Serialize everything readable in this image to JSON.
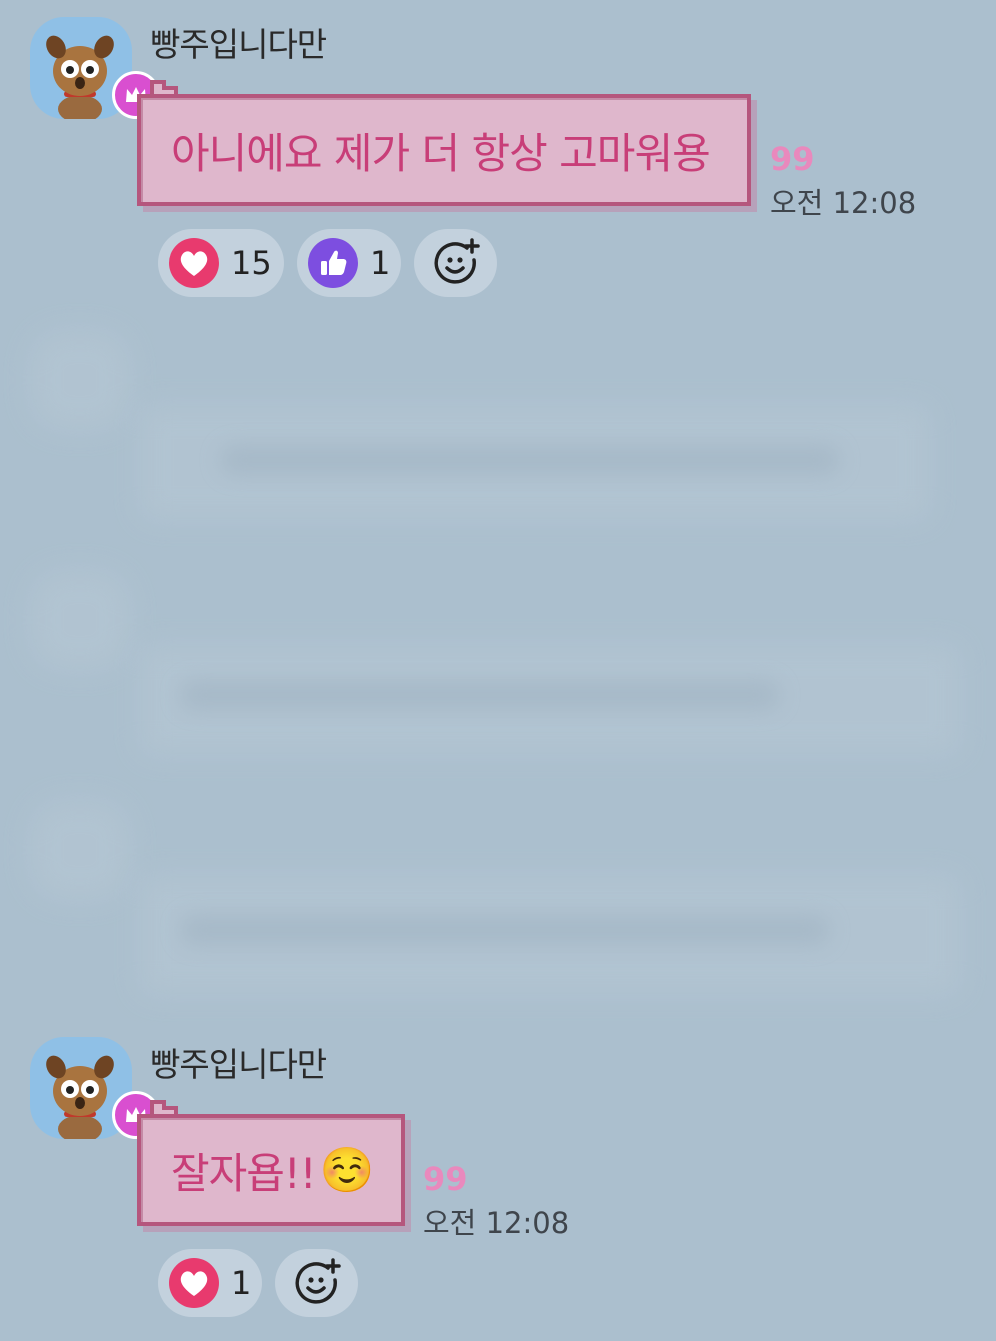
{
  "colors": {
    "background": "#abbfce",
    "bubble_fill": "#dfb7cc",
    "bubble_border": "#b5567d",
    "bubble_text": "#c83e78",
    "read_count": "#e989bd",
    "crown_badge": "#d94fd0",
    "heart_reaction": "#e83a6e",
    "thumbs_reaction": "#7d4ee0"
  },
  "messages": [
    {
      "sender": "빵주입니다만",
      "avatar_icon": "dog-character-icon",
      "badge_icon": "crown-icon",
      "text": "아니에요 제가 더 항상 고마워용",
      "read_count": "99",
      "time": "오전 12:08",
      "reactions": [
        {
          "icon": "heart-icon",
          "count": "15"
        },
        {
          "icon": "thumbs-up-icon",
          "count": "1"
        }
      ],
      "add_reaction_icon": "add-emoji-icon"
    },
    {
      "sender": "빵주입니다만",
      "avatar_icon": "dog-character-icon",
      "badge_icon": "crown-icon",
      "text": "잘자욥!!",
      "emoji": "☺️",
      "read_count": "99",
      "time": "오전 12:08",
      "reactions": [
        {
          "icon": "heart-icon",
          "count": "1"
        }
      ],
      "add_reaction_icon": "add-emoji-icon"
    }
  ]
}
